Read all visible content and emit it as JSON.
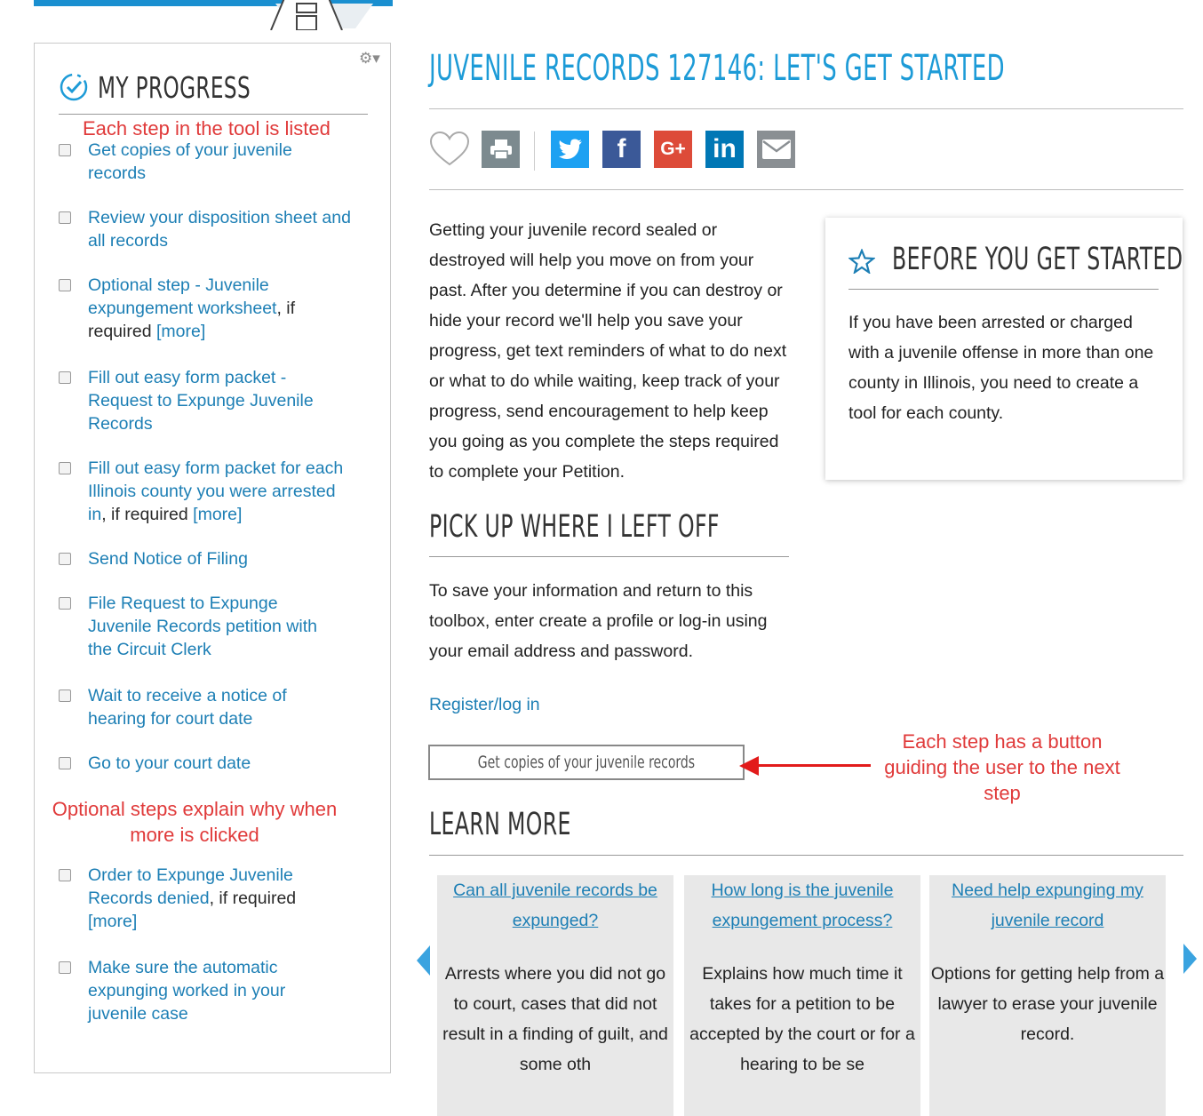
{
  "progress": {
    "title": "MY PROGRESS",
    "note_top": "Each step in the tool is listed",
    "note_mid": "Optional steps explain why when more is clicked",
    "steps": [
      {
        "link": "Get copies of your juvenile records",
        "rest": "",
        "more": ""
      },
      {
        "link": "Review your disposition sheet and all records",
        "rest": "",
        "more": ""
      },
      {
        "link": "Optional step - Juvenile expungement worksheet",
        "rest": ", if required ",
        "more": "[more]"
      },
      {
        "link": "Fill out easy form packet - Request to Expunge Juvenile Records",
        "rest": "",
        "more": ""
      },
      {
        "link": "Fill out easy form packet for each Illinois county you were arrested in",
        "rest": ", if required ",
        "more": "[more]"
      },
      {
        "link": "Send Notice of Filing",
        "rest": "",
        "more": ""
      },
      {
        "link": "File Request to Expunge Juvenile Records petition with the Circuit Clerk",
        "rest": "",
        "more": ""
      },
      {
        "link": "Wait to receive a notice of hearing for court date",
        "rest": "",
        "more": ""
      },
      {
        "link": "Go to your court date",
        "rest": "",
        "more": ""
      },
      {
        "link": "Order to Expunge Juvenile Records denied",
        "rest": ", if required ",
        "more": "[more]"
      },
      {
        "link": "Make sure the automatic expunging worked in your juvenile case",
        "rest": "",
        "more": ""
      }
    ]
  },
  "main": {
    "title": "JUVENILE RECORDS 127146: LET'S GET STARTED",
    "intro": "Getting your juvenile record sealed or destroyed will help you move on from your past. After you determine if you can destroy or hide your record we'll help you save your progress, get text reminders of what to do next or what to do while waiting, keep track of your progress, send encouragement to help keep you going as you complete the steps required to complete your Petition.",
    "pickup_title": "PICK UP WHERE I LEFT OFF",
    "save_text": "To save your information and return to this toolbox, enter create a profile or log-in using your email address and password.",
    "register_link": "Register/log in",
    "next_button": "Get copies of your juvenile records",
    "button_note": "Each step has a button guiding the user to the next step",
    "learn_title": "LEARN MORE"
  },
  "before": {
    "title": "BEFORE YOU GET STARTED",
    "body": "If you have been arrested or charged with a juvenile offense in more than one county in Illinois, you need to create a tool for each county."
  },
  "share": {
    "google_label": "G+",
    "linkedin_label": "in",
    "facebook_label": "f"
  },
  "cards": [
    {
      "question": "Can all juvenile records be expunged?",
      "answer": "Arrests where you did not go to court, cases that did not result in a finding of guilt, and some oth"
    },
    {
      "question": "How long is the juvenile expungement process?",
      "answer": "Explains how much time it takes for a petition to be accepted by the court or for a hearing to be se"
    },
    {
      "question": "Need help expunging my juvenile record",
      "answer": "Options for getting help from a lawyer to erase your juvenile record."
    }
  ],
  "colors": {
    "accent": "#1d9bd7",
    "link": "#1d7fb5",
    "annotation": "#e03a3a",
    "twitter": "#1da1f2",
    "facebook": "#3b5998",
    "google": "#dd4b39",
    "linkedin": "#0077b5",
    "mail": "#8a8f93"
  }
}
